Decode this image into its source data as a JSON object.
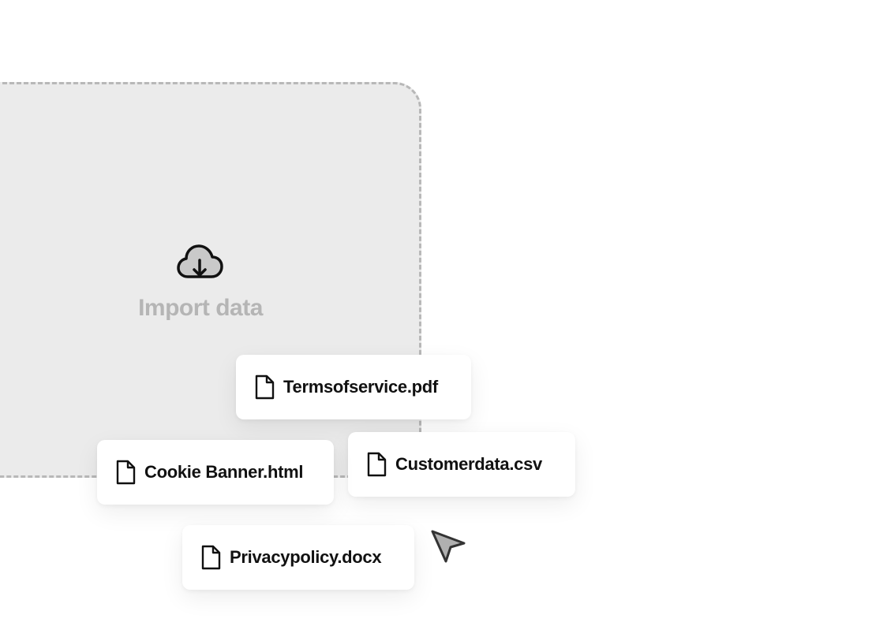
{
  "dropzone": {
    "icon": "cloud-download-icon",
    "label": "Import data"
  },
  "files": [
    {
      "name": "Termsofservice.pdf",
      "icon": "file-icon"
    },
    {
      "name": "Customerdata.csv",
      "icon": "file-icon"
    },
    {
      "name": "Cookie Banner.html",
      "icon": "file-icon"
    },
    {
      "name": "Privacypolicy.docx",
      "icon": "file-icon"
    }
  ],
  "cursor": {
    "icon": "pointer-cursor-icon"
  },
  "colors": {
    "dropzone_background": "#ebebeb",
    "dropzone_border": "#b8b8b8",
    "label_muted": "#b5b5b5",
    "text_primary": "#111111"
  }
}
